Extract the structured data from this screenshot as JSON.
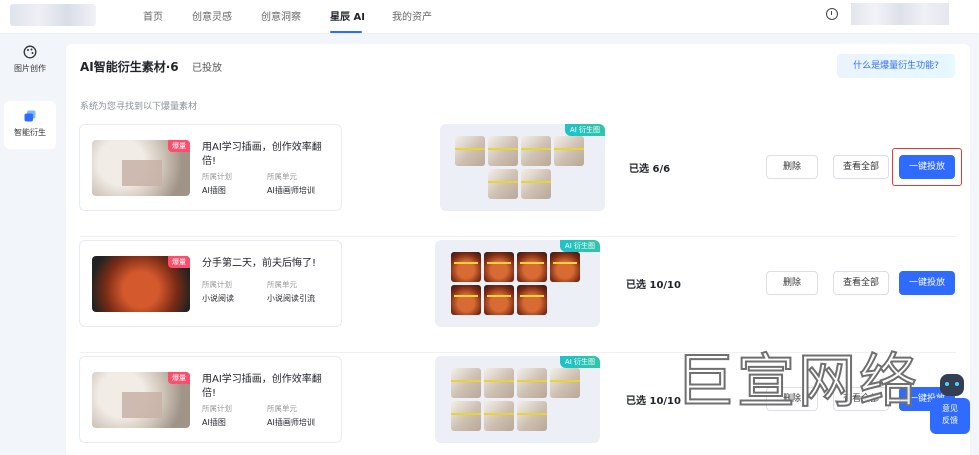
{
  "topnav": {
    "items": [
      "首页",
      "创意灵感",
      "创意洞察",
      "星辰 AI",
      "我的资产"
    ],
    "active_index": 3
  },
  "leftnav": {
    "items": [
      {
        "label": "图片创作",
        "icon": "palette-icon"
      },
      {
        "label": "智能衍生",
        "icon": "layers-icon"
      }
    ],
    "active_index": 1
  },
  "panel": {
    "title": "AI智能衍生素材·6",
    "tab2": "已投放",
    "help_link": "什么是爆量衍生功能?",
    "subtitle": "系统为您寻找到以下爆量素材"
  },
  "rows": [
    {
      "hot_badge": "爆量",
      "title": "用AI学习插画，创作效率翻倍!",
      "plan_label": "所属计划",
      "unit_label": "所属单元",
      "plan_value": "AI插图",
      "unit_value": "AI插画师培训",
      "ai_tag": "AI 衍生图",
      "selected": "已选 6/6",
      "delete": "删除",
      "view_all": "查看全部",
      "launch": "一键投放"
    },
    {
      "hot_badge": "爆量",
      "title": "分手第二天，前夫后悔了!",
      "plan_label": "所属计划",
      "unit_label": "所属单元",
      "plan_value": "小说阅读",
      "unit_value": "小说阅读引流",
      "ai_tag": "AI 衍生图",
      "selected": "已选 10/10",
      "delete": "删除",
      "view_all": "查看全部",
      "launch": "一键投放"
    },
    {
      "hot_badge": "爆量",
      "title": "用AI学习插画，创作效率翻倍!",
      "plan_label": "所属计划",
      "unit_label": "所属单元",
      "plan_value": "AI插图",
      "unit_value": "AI插画师培训",
      "ai_tag": "AI 衍生图",
      "selected": "已选 10/10",
      "delete": "删除",
      "view_all": "查看全部",
      "launch": "一键投放"
    }
  ],
  "watermark": "巨宣网络",
  "feedback": {
    "line1": "意见",
    "line2": "反馈"
  },
  "colors": {
    "accent": "#2f6bff",
    "highlight": "#e53935",
    "hot": "#ff4d6d"
  }
}
